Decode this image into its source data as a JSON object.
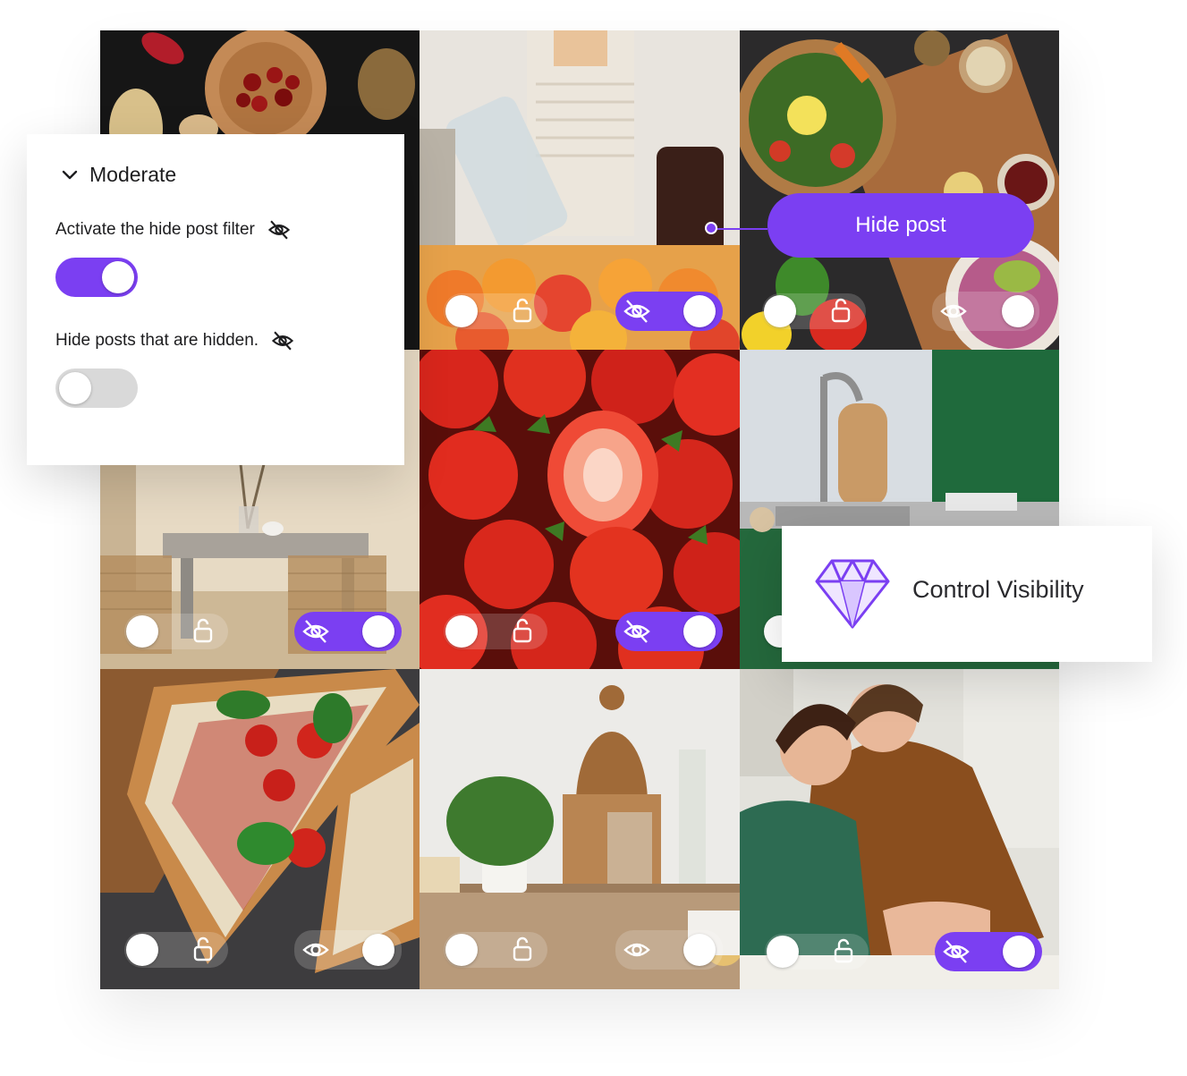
{
  "panel": {
    "title": "Moderate",
    "chevron_icon": "chevron-down-icon",
    "filter_label": "Activate the hide post filter",
    "filter_toggle_on": true,
    "hidden_label": "Hide posts that are hidden.",
    "hidden_toggle_on": false,
    "label_icon": "eye-off-icon"
  },
  "hide_post_button": {
    "label": "Hide post"
  },
  "control_card": {
    "label": "Control Visibility",
    "icon": "diamond-icon"
  },
  "colors": {
    "accent": "#7b3ff2",
    "toggle_off": "#d9d9d9",
    "text": "#1d1d1f"
  },
  "tiles": [
    {
      "name": "tile-dried-fruit",
      "visibility": "none"
    },
    {
      "name": "tile-juice",
      "visibility": "hidden"
    },
    {
      "name": "tile-salad",
      "visibility": "visible"
    },
    {
      "name": "tile-dining-room",
      "visibility": "hidden"
    },
    {
      "name": "tile-strawberries",
      "visibility": "hidden"
    },
    {
      "name": "tile-kitchen-sink",
      "visibility": "none"
    },
    {
      "name": "tile-pizza",
      "visibility": "visible"
    },
    {
      "name": "tile-kitchen-counter",
      "visibility": "visible"
    },
    {
      "name": "tile-couple-cooking",
      "visibility": "hidden"
    }
  ]
}
